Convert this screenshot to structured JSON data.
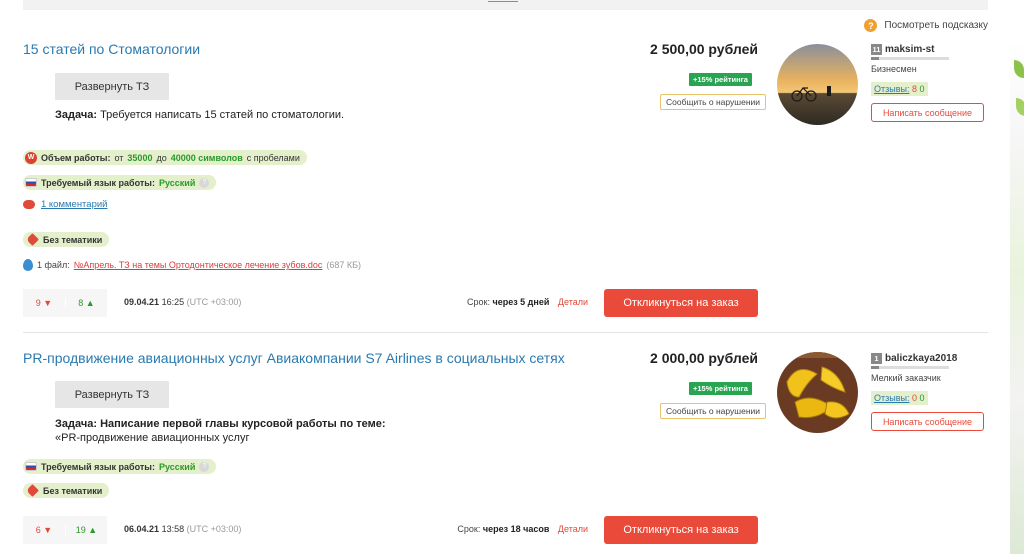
{
  "hint": {
    "label": "Посмотреть подсказку",
    "icon": "question-icon"
  },
  "orders": [
    {
      "title": "15 статей по Стоматологии",
      "price": "2 500,00 рублей",
      "rating_badge": "+15% рейтинга",
      "report_label": "Сообщить о нарушении",
      "expand_label": "Развернуть ТЗ",
      "task_label": "Задача:",
      "task_text": " Требуется написать 15 статей по стоматологии.",
      "volume": {
        "label": "Объем работы:",
        "from": "от",
        "min": "35000",
        "to": "до",
        "max": "40000 символов",
        "suffix": "с пробелами"
      },
      "language": {
        "label": "Требуемый язык работы:",
        "value": "Русский"
      },
      "comments": "1 комментарий",
      "topic": "Без тематики",
      "file": {
        "label": "1 файл:",
        "name": "№Апрель. ТЗ на темы Ортодонтическое лечение зубов.doc",
        "size": "(687 КБ)"
      },
      "votes_down": "9",
      "votes_up": "8",
      "date": "09.04.21",
      "time": "16:25",
      "tz": "(UTC +03:00)",
      "deadline_label": "Срок:",
      "deadline_value": "через 5 дней",
      "details_label": "Детали",
      "respond_label": "Откликнуться на заказ",
      "user": {
        "level": "11",
        "name": "maksim-st",
        "level_progress": 0.1,
        "role": "Бизнесмен",
        "reviews_label": "Отзывы:",
        "reviews_neg": "8",
        "reviews_pos": "0",
        "message_label": "Написать сообщение"
      }
    },
    {
      "title": "PR-продвижение авиационных услуг Авиакомпании S7 Airlines в социальных сетях",
      "price": "2 000,00 рублей",
      "rating_badge": "+15% рейтинга",
      "report_label": "Сообщить о нарушении",
      "expand_label": "Развернуть ТЗ",
      "task_label": "Задача:",
      "task_text": " Написание первой главы курсовой работы по теме:",
      "task_text2": "«PR-продвижение авиационных услуг",
      "language": {
        "label": "Требуемый язык работы:",
        "value": "Русский"
      },
      "topic": "Без тематики",
      "votes_down": "6",
      "votes_up": "19",
      "date": "06.04.21",
      "time": "13:58",
      "tz": "(UTC +03:00)",
      "deadline_label": "Срок:",
      "deadline_value": "через 18 часов",
      "details_label": "Детали",
      "respond_label": "Откликнуться на заказ",
      "user": {
        "level": "1",
        "name": "baliczkaya2018",
        "level_progress": 0.1,
        "role": "Мелкий заказчик",
        "reviews_label": "Отзывы:",
        "reviews_neg": "0",
        "reviews_pos": "0",
        "message_label": "Написать сообщение"
      }
    }
  ],
  "colors": {
    "accent": "#e94a3a",
    "link": "#2a7ab0",
    "green_badge": "#29a551",
    "pill_bg": "#e4efcc"
  }
}
